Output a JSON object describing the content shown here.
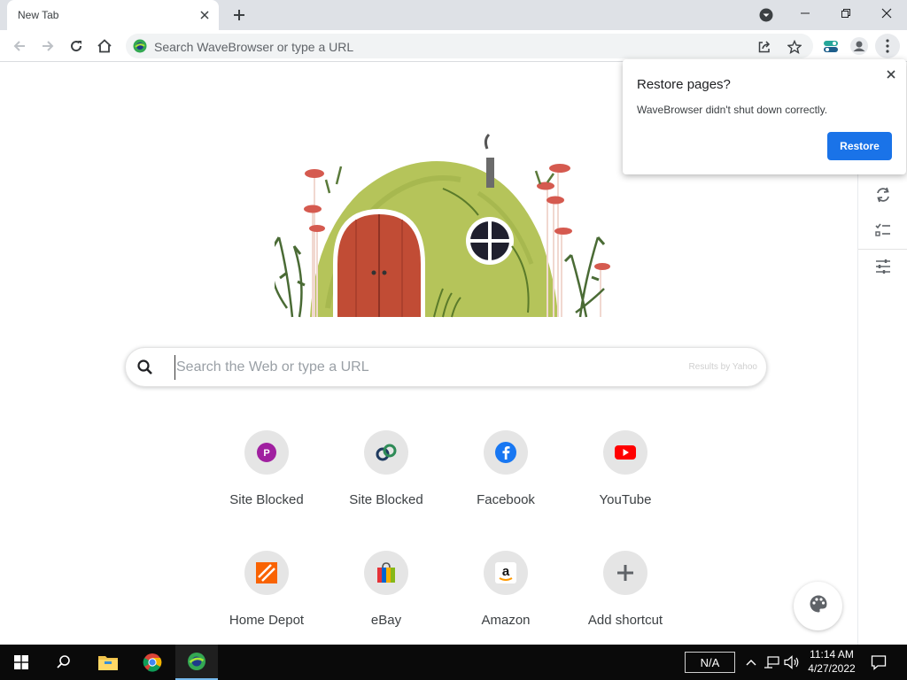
{
  "tab": {
    "title": "New Tab"
  },
  "omnibox": {
    "placeholder": "Search WaveBrowser or type a URL"
  },
  "search": {
    "placeholder": "Search the Web or type a URL",
    "powered_by": "Results by Yahoo"
  },
  "shortcuts": [
    {
      "label": "Site Blocked",
      "icon": "p-letter-icon"
    },
    {
      "label": "Site Blocked",
      "icon": "link-icon"
    },
    {
      "label": "Facebook",
      "icon": "facebook-icon"
    },
    {
      "label": "YouTube",
      "icon": "youtube-icon"
    },
    {
      "label": "Home Depot",
      "icon": "home-depot-icon"
    },
    {
      "label": "eBay",
      "icon": "ebay-bag-icon"
    },
    {
      "label": "Amazon",
      "icon": "amazon-icon"
    },
    {
      "label": "Add shortcut",
      "icon": "plus-icon"
    }
  ],
  "popup": {
    "title": "Restore pages?",
    "message": "WaveBrowser didn't shut down correctly.",
    "button": "Restore"
  },
  "taskbar": {
    "language": "N/A",
    "time": "11:14 AM",
    "date": "4/27/2022"
  },
  "colors": {
    "accent": "#1a73e8",
    "tab_strip": "#dee1e6",
    "taskbar": "#0a0a0a"
  }
}
